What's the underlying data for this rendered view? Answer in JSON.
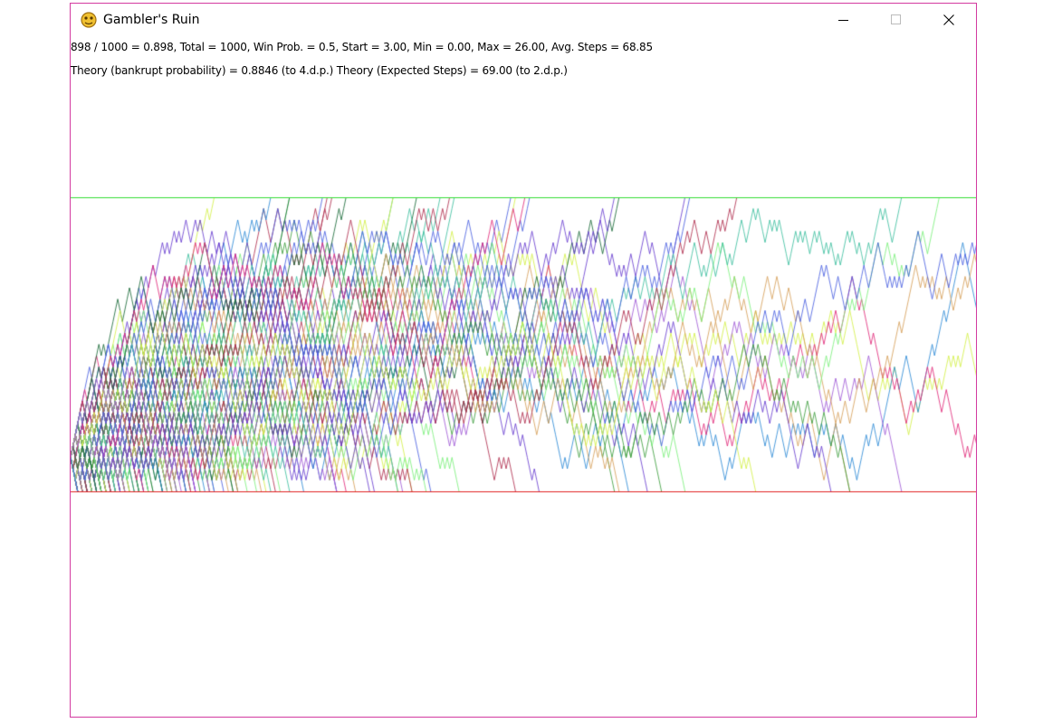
{
  "window": {
    "title": "Gambler's Ruin",
    "controls": {
      "minimize_icon": "minimize-icon",
      "maximize_icon": "maximize-icon",
      "close_icon": "close-icon"
    }
  },
  "stats": {
    "line1": "898 / 1000 = 0.898, Total = 1000, Win Prob. = 0.5, Start = 3.00, Min = 0.00, Max = 26.00, Avg. Steps = 68.85",
    "line2": "Theory (bankrupt probability) = 0.8846 (to 4.d.p.)  Theory (Expected Steps) = 69.00 (to 2.d.p.)"
  },
  "simulation": {
    "bankrupt_count": 898,
    "total": 1000,
    "win_prob": 0.5,
    "start": 3.0,
    "min": 0.0,
    "max": 26.0,
    "avg_steps": 68.85,
    "upper_bound_color": "#33dd33",
    "lower_bound_color": "#e02020",
    "walk_colors": [
      "#4b62e0",
      "#3f9f3f",
      "#7cf07c",
      "#e02a7a",
      "#1b6b3a",
      "#d4f04a",
      "#2e8bd6",
      "#a05ad6",
      "#d6a05a",
      "#3fbfa0",
      "#b03050",
      "#6a3fd0"
    ]
  }
}
